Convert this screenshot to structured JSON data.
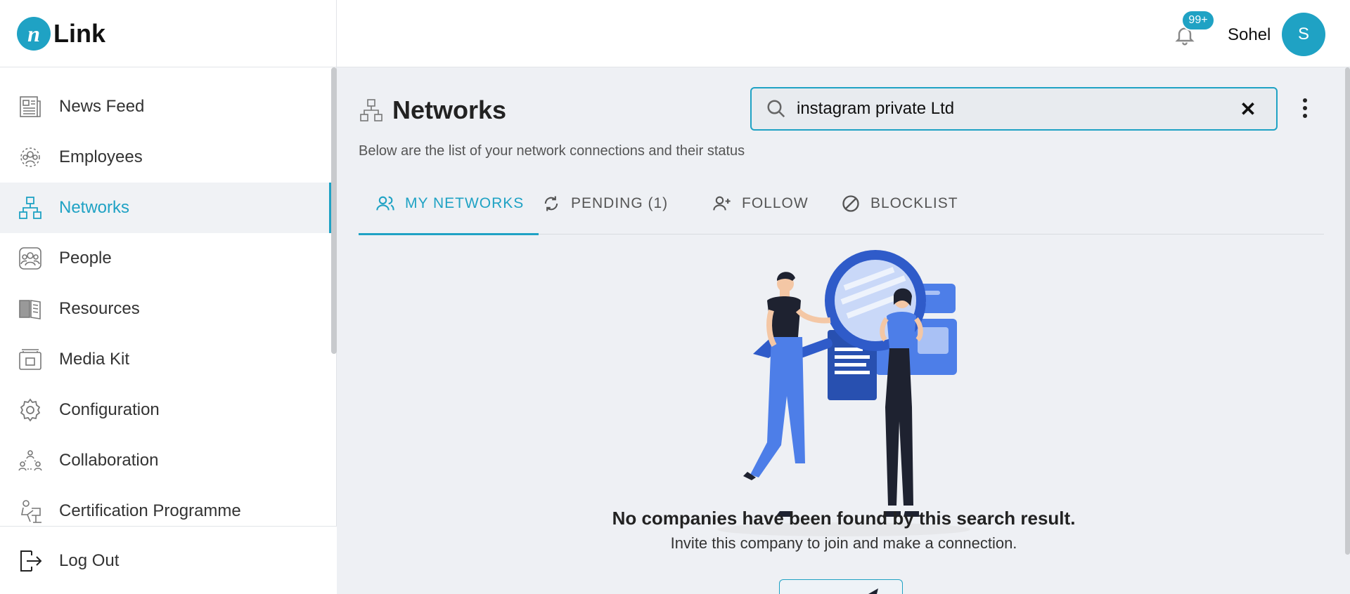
{
  "brand": {
    "logo_glyph": "n",
    "name": "Link",
    "accent_color": "#1fa2c4"
  },
  "header": {
    "notification_count": "99+",
    "user_name": "Sohel",
    "avatar_initial": "S"
  },
  "sidebar": {
    "items": [
      {
        "label": "News Feed",
        "icon": "newspaper-icon"
      },
      {
        "label": "Employees",
        "icon": "employees-icon"
      },
      {
        "label": "Networks",
        "icon": "network-icon",
        "active": true
      },
      {
        "label": "People",
        "icon": "people-icon"
      },
      {
        "label": "Resources",
        "icon": "book-icon"
      },
      {
        "label": "Media Kit",
        "icon": "media-kit-icon"
      },
      {
        "label": "Configuration",
        "icon": "gear-icon"
      },
      {
        "label": "Collaboration",
        "icon": "collaboration-icon"
      },
      {
        "label": "Certification Programme",
        "icon": "certification-icon"
      }
    ],
    "logout_label": "Log Out"
  },
  "main": {
    "title": "Networks",
    "subtitle": "Below are the list of your network connections and their status",
    "search": {
      "value": "instagram private Ltd"
    },
    "tabs": [
      {
        "label": "MY NETWORKS",
        "icon": "users-icon",
        "active": true
      },
      {
        "label": "PENDING (1)",
        "icon": "refresh-icon"
      },
      {
        "label": "FOLLOW",
        "icon": "user-add-icon"
      },
      {
        "label": "BLOCKLIST",
        "icon": "block-icon"
      }
    ],
    "empty_state": {
      "title": "No companies have been found by this search result.",
      "message": "Invite this company to join and make a connection."
    }
  }
}
